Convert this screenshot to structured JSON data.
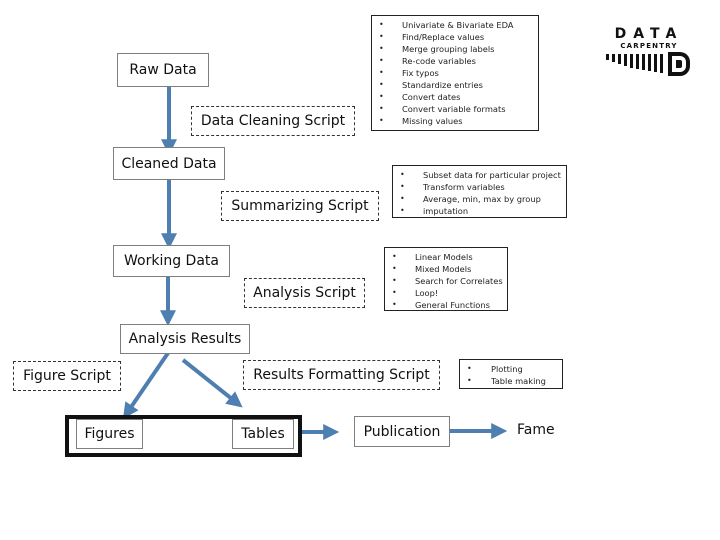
{
  "nodes": {
    "raw_data": "Raw Data",
    "data_cleaning_script": "Data Cleaning Script",
    "cleaned_data": "Cleaned Data",
    "summarizing_script": "Summarizing Script",
    "working_data": "Working Data",
    "analysis_script": "Analysis Script",
    "analysis_results": "Analysis Results",
    "figure_script": "Figure Script",
    "results_formatting_script": "Results Formatting Script",
    "figures": "Figures",
    "tables": "Tables",
    "publication": "Publication",
    "fame": "Fame"
  },
  "notes": {
    "cleaning": [
      "Univariate & Bivariate EDA",
      "Find/Replace values",
      "Merge grouping labels",
      "Re-code variables",
      "Fix typos",
      "Standardize entries",
      "Convert dates",
      "Convert variable formats",
      "Missing values"
    ],
    "summarizing": [
      "Subset data for particular project",
      "Transform variables",
      "Average, min, max by group",
      "imputation"
    ],
    "analysis": [
      "Linear Models",
      "Mixed Models",
      "Search for Correlates",
      "Loop!",
      "General Functions"
    ],
    "formatting": [
      "Plotting",
      "Table making"
    ]
  },
  "bullet": "•",
  "logo": {
    "line1": "DATA",
    "line2": "CARPENTRY",
    "mark": "D"
  },
  "colors": {
    "arrow": "#4f7fb0",
    "box_border": "#7f7f7f"
  }
}
